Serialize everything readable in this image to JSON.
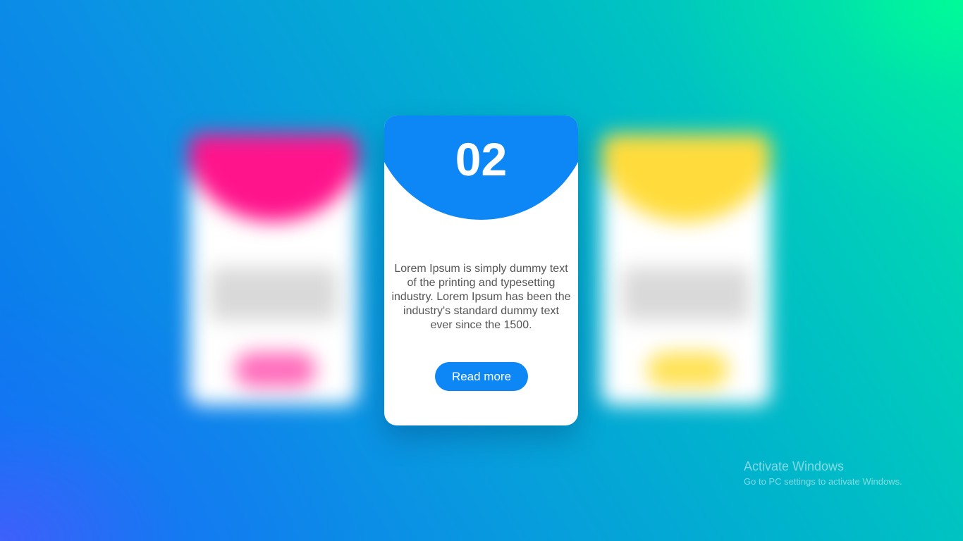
{
  "theme": {
    "accent": "#0d87f5",
    "left_card_accent": "#ff148c",
    "right_card_accent": "#ffdc3c"
  },
  "cards": {
    "center": {
      "number": "02",
      "description": "Lorem Ipsum is simply dummy text of the printing and typesetting industry. Lorem Ipsum has been the industry's standard dummy text ever since the 1500.",
      "button_label": "Read more"
    }
  },
  "watermark": {
    "title": "Activate Windows",
    "subtitle": "Go to PC settings to activate Windows."
  }
}
